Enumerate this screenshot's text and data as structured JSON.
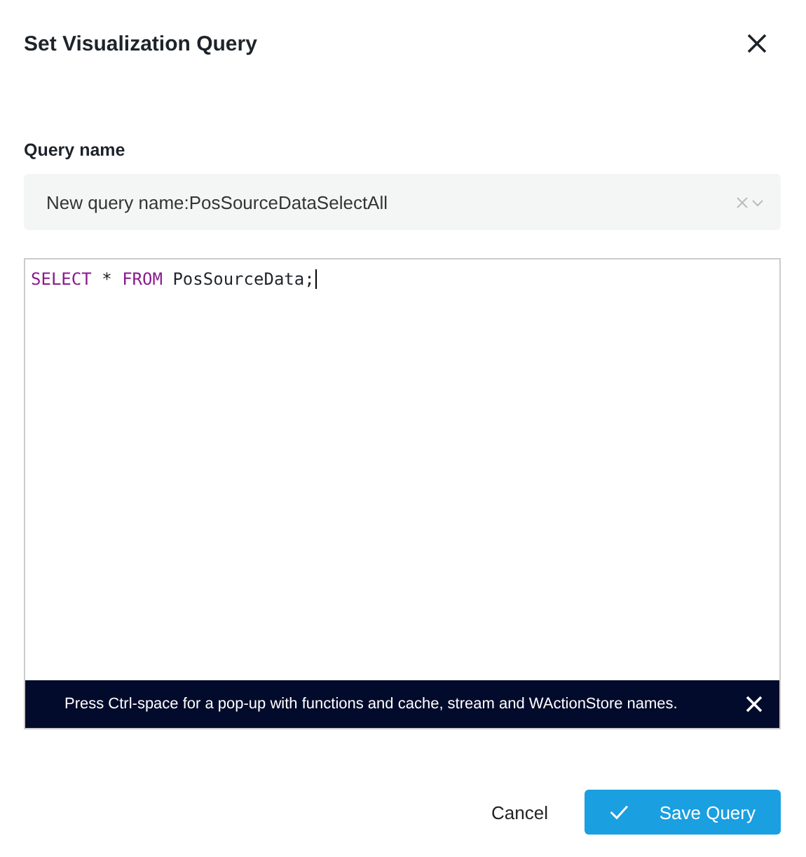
{
  "dialog": {
    "title": "Set Visualization Query"
  },
  "query_name": {
    "label": "Query name",
    "value": "New query name:PosSourceDataSelectAll"
  },
  "editor": {
    "tokens": [
      {
        "text": "SELECT",
        "kind": "keyword"
      },
      {
        "text": "*",
        "kind": "plain"
      },
      {
        "text": "FROM",
        "kind": "keyword"
      },
      {
        "text": "PosSourceData;",
        "kind": "plain"
      }
    ],
    "hint": "Press Ctrl-space for a pop-up with functions and cache, stream and WActionStore names."
  },
  "buttons": {
    "cancel": "Cancel",
    "save": "Save Query"
  }
}
